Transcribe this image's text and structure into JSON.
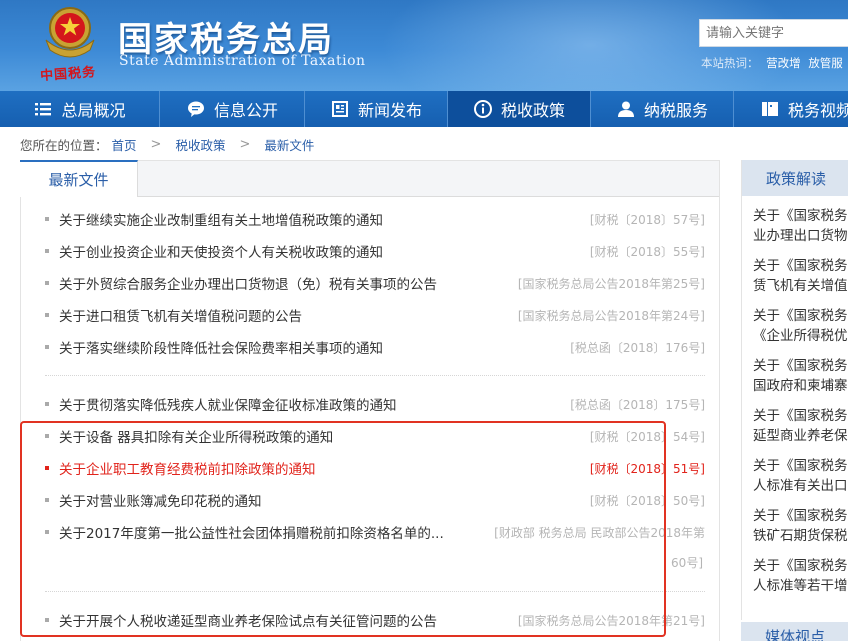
{
  "header": {
    "seal_text": "中国税务",
    "title": "国家税务总局",
    "subtitle": "State Administration of Taxation",
    "search_placeholder": "请输入关键字",
    "hot_label": "本站热词：",
    "hot_words": [
      "营改增",
      "放管服"
    ]
  },
  "nav": {
    "items": [
      {
        "label": "总局概况",
        "icon": "menu-icon"
      },
      {
        "label": "信息公开",
        "icon": "speech-bubble-icon"
      },
      {
        "label": "新闻发布",
        "icon": "newspaper-icon"
      },
      {
        "label": "税收政策",
        "icon": "info-icon",
        "active": true
      },
      {
        "label": "纳税服务",
        "icon": "user-icon"
      },
      {
        "label": "税务视频",
        "icon": "video-icon"
      }
    ]
  },
  "breadcrumb": {
    "prefix": "您所在的位置：",
    "items": [
      "首页",
      "税收政策",
      "最新文件"
    ],
    "separator": ">"
  },
  "main": {
    "tab_label": "最新文件",
    "items": [
      {
        "title": "关于继续实施企业改制重组有关土地增值税政策的通知",
        "doc": "[财税〔2018〕57号]"
      },
      {
        "title": "关于创业投资企业和天使投资个人有关税收政策的通知",
        "doc": "[财税〔2018〕55号]"
      },
      {
        "title": "关于外贸综合服务企业办理出口货物退（免）税有关事项的公告",
        "doc": "[国家税务总局公告2018年第25号]"
      },
      {
        "title": "关于进口租赁飞机有关增值税问题的公告",
        "doc": "[国家税务总局公告2018年第24号]"
      },
      {
        "title": "关于落实继续阶段性降低社会保险费率相关事项的通知",
        "doc": "[税总函〔2018〕176号]"
      },
      {
        "title": "关于贯彻落实降低残疾人就业保障金征收标准政策的通知",
        "doc": "[税总函〔2018〕175号]"
      },
      {
        "title": "关于设备 器具扣除有关企业所得税政策的通知",
        "doc": "[财税〔2018〕54号]"
      },
      {
        "title": "关于企业职工教育经费税前扣除政策的通知",
        "doc": "[财税〔2018〕51号]",
        "highlight": true
      },
      {
        "title": "关于对营业账簿减免印花税的通知",
        "doc": "[财税〔2018〕50号]"
      },
      {
        "title": "关于2017年度第一批公益性社会团体捐赠税前扣除资格名单的...",
        "doc": "[财政部 税务总局 民政部公告2018年第",
        "doc_cont": "60号]"
      },
      {
        "title": "关于开展个人税收递延型商业养老保险试点有关征管问题的公告",
        "doc": "[国家税务总局公告2018年第21号]"
      }
    ]
  },
  "side": {
    "tab_label": "政策解读",
    "items": [
      [
        "关于《国家税务",
        "业办理出口货物"
      ],
      [
        "关于《国家税务",
        "赁飞机有关增值"
      ],
      [
        "关于《国家税务",
        "《企业所得税优"
      ],
      [
        "关于《国家税务",
        "国政府和柬埔寨"
      ],
      [
        "关于《国家税务",
        "延型商业养老保"
      ],
      [
        "关于《国家税务",
        "人标准有关出口"
      ],
      [
        "关于《国家税务",
        "铁矿石期货保税"
      ],
      [
        "关于《国家税务",
        "人标准等若干增"
      ]
    ],
    "bottom_tab_label": "媒体视点"
  }
}
